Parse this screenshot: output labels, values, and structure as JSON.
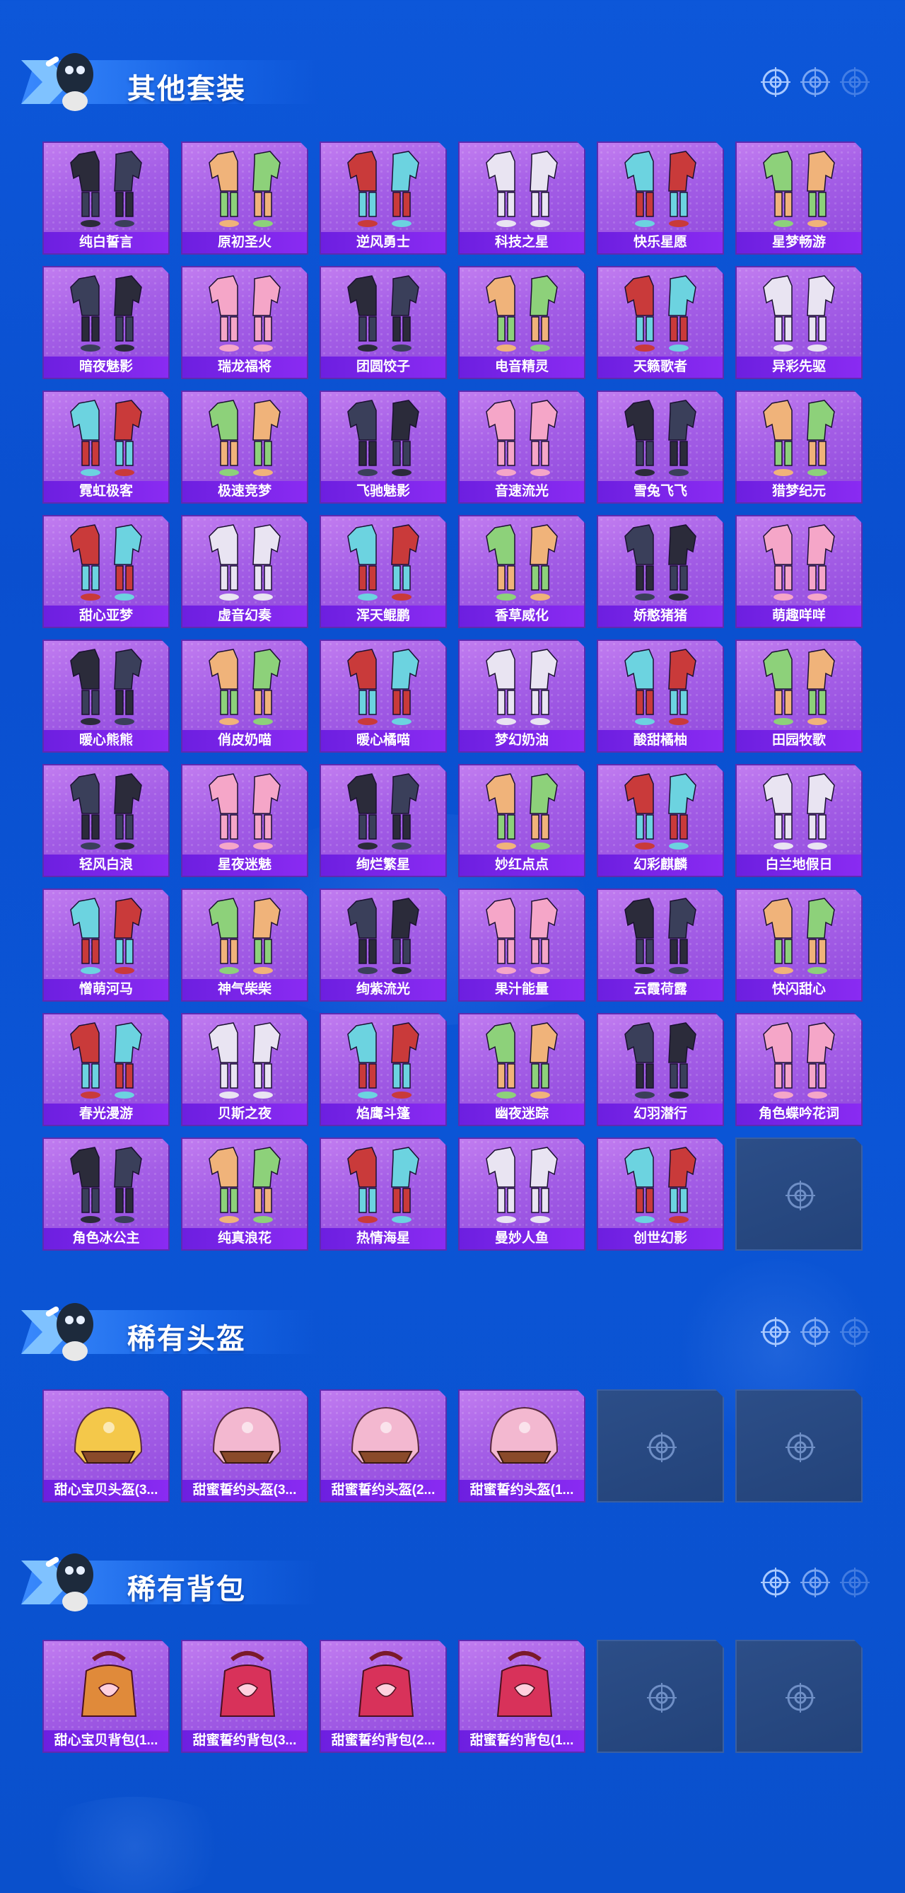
{
  "sections": [
    {
      "title": "其他套装",
      "items": [
        "纯白誓言",
        "原初圣火",
        "逆风勇士",
        "科技之星",
        "快乐星愿",
        "星梦畅游",
        "暗夜魅影",
        "瑞龙福将",
        "团圆饺子",
        "电音精灵",
        "天籁歌者",
        "异彩先驱",
        "霓虹极客",
        "极速竞梦",
        "飞驰魅影",
        "音速流光",
        "雪兔飞飞",
        "猎梦纪元",
        "甜心亚梦",
        "虚音幻奏",
        "浑天鲲鹏",
        "香草威化",
        "娇憨猪猪",
        "萌趣咩咩",
        "暖心熊熊",
        "俏皮奶喵",
        "暖心橘喵",
        "梦幻奶油",
        "酸甜橘柚",
        "田园牧歌",
        "轻风白浪",
        "星夜迷魅",
        "绚烂繁星",
        "妙红点点",
        "幻彩麒麟",
        "白兰地假日",
        "憎萌河马",
        "神气柴柴",
        "绚紫流光",
        "果汁能量",
        "云霞荷露",
        "快闪甜心",
        "春光漫游",
        "贝斯之夜",
        "焰鹰斗篷",
        "幽夜迷踪",
        "幻羽潜行",
        "角色蝶吟花词",
        "角色冰公主",
        "纯真浪花",
        "热情海星",
        "曼妙人鱼",
        "创世幻影"
      ],
      "empty_slots": 1
    },
    {
      "title": "稀有头盔",
      "items": [
        "甜心宝贝头盔(3...",
        "甜蜜誓约头盔(3...",
        "甜蜜誓约头盔(2...",
        "甜蜜誓约头盔(1..."
      ],
      "empty_slots": 2
    },
    {
      "title": "稀有背包",
      "items": [
        "甜心宝贝背包(1...",
        "甜蜜誓约背包(3...",
        "甜蜜誓约背包(2...",
        "甜蜜誓约背包(1..."
      ],
      "empty_slots": 2
    }
  ],
  "icons": {
    "header_target": "crosshair-target-icon",
    "empty_slot": "crosshair-target-icon",
    "mascot": "mascot-icon"
  },
  "colors": {
    "background": "#0b53d3",
    "card_purple": "#a45ee6",
    "label_bar": "#7a25ea",
    "empty_slot": "#274a84"
  }
}
